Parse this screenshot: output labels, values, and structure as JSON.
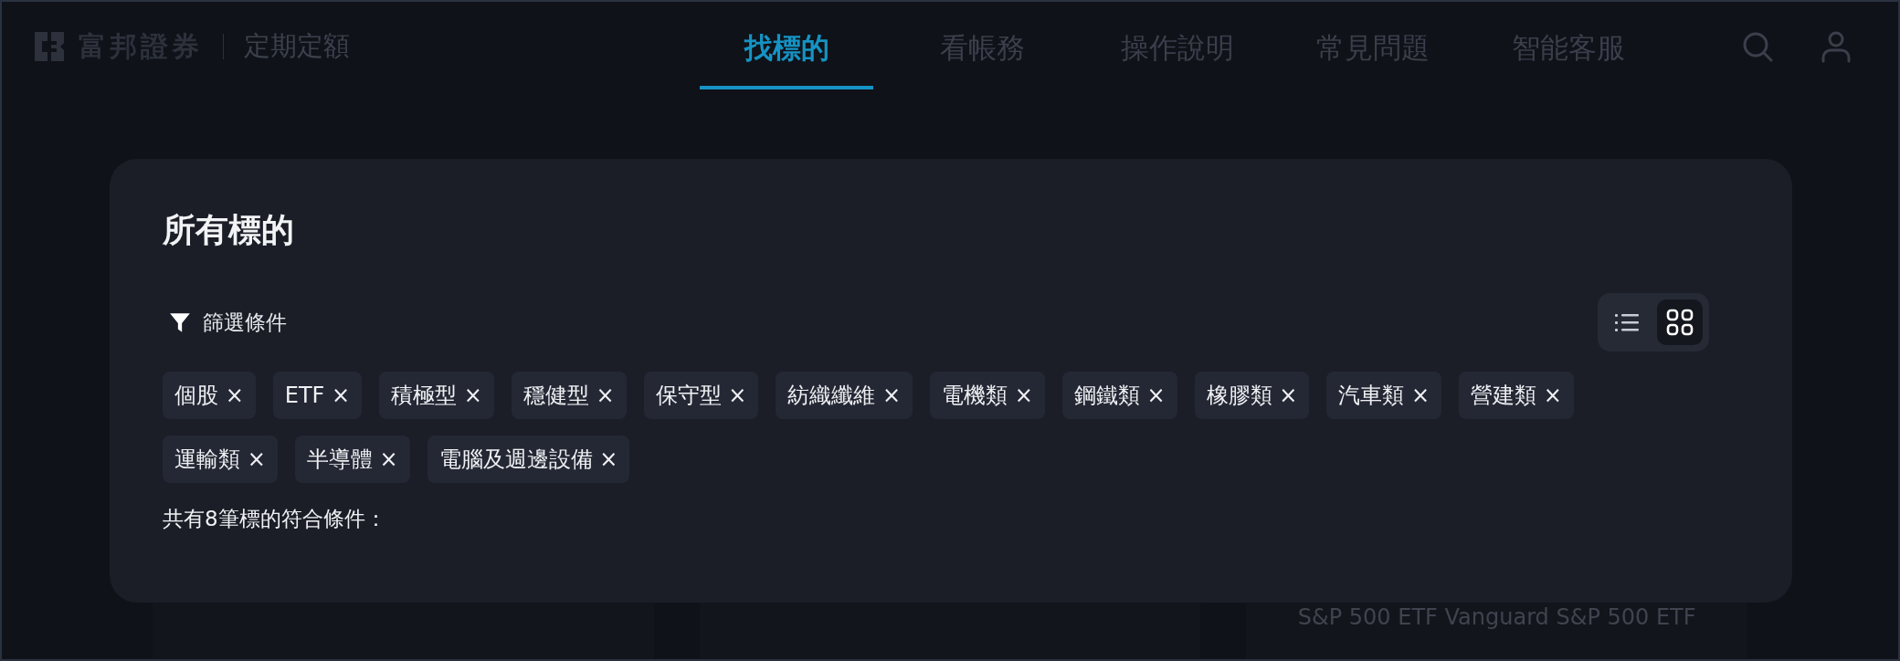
{
  "header": {
    "brand": "富邦證券",
    "product": "定期定額",
    "nav": [
      {
        "label": "找標的",
        "selected": true
      },
      {
        "label": "看帳務",
        "selected": false
      },
      {
        "label": "操作說明",
        "selected": false
      },
      {
        "label": "常見問題",
        "selected": false
      },
      {
        "label": "智能客服",
        "selected": false
      }
    ]
  },
  "panel": {
    "title": "所有標的",
    "filter_label": "篩選條件",
    "view_modes": [
      {
        "kind": "list",
        "selected": false
      },
      {
        "kind": "grid",
        "selected": true
      }
    ],
    "tags": [
      {
        "label": "個股",
        "remove": "×"
      },
      {
        "label": "ETF",
        "remove": "×"
      },
      {
        "label": "積極型",
        "remove": "×"
      },
      {
        "label": "穩健型",
        "remove": "×"
      },
      {
        "label": "保守型",
        "remove": "×"
      },
      {
        "label": "紡織纖維",
        "remove": "×"
      },
      {
        "label": "電機類",
        "remove": "×"
      },
      {
        "label": "鋼鐵類",
        "remove": "×"
      },
      {
        "label": "橡膠類",
        "remove": "×"
      },
      {
        "label": "汽車類",
        "remove": "×"
      },
      {
        "label": "營建類",
        "remove": "×"
      },
      {
        "label": "運輸類",
        "remove": "×"
      },
      {
        "label": "半導體",
        "remove": "×"
      },
      {
        "label": "電腦及週邊設備",
        "remove": "×"
      }
    ],
    "result_count": "共有8筆標的符合條件："
  },
  "cards": [
    {
      "title": "S&P 500 ETF Vanguard S&P 500 ETF"
    }
  ]
}
